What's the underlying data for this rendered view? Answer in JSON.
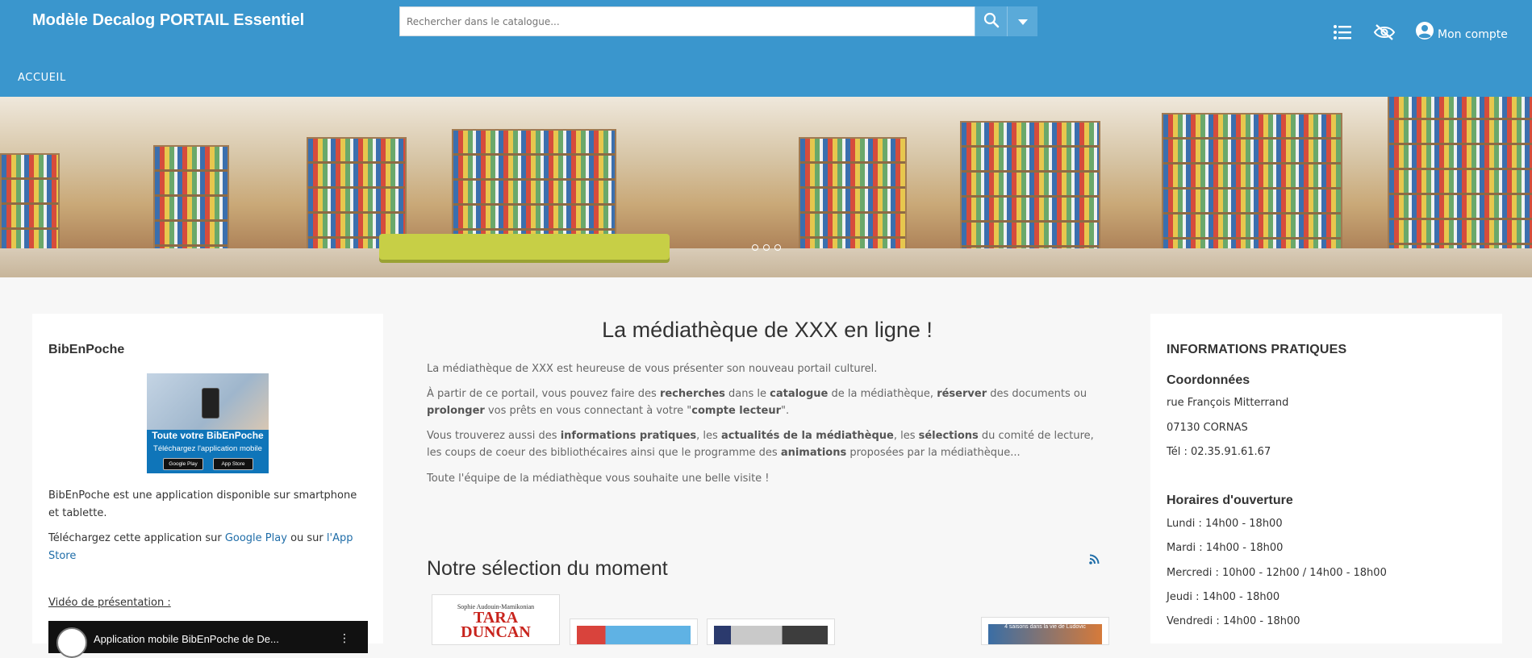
{
  "header": {
    "site_title": "Modèle Decalog PORTAIL Essentiel",
    "search_placeholder": "Rechercher dans le catalogue...",
    "account_label": "Mon compte",
    "nav_home": "ACCUEIL"
  },
  "left": {
    "title": "BibEnPoche",
    "app_title": "Toute votre BibEnPoche",
    "app_sub": "Téléchargez l'application mobile",
    "badge_google": "Google Play",
    "badge_apple": "App Store",
    "desc": "BibEnPoche est une application disponible sur smartphone et tablette.",
    "download_prefix": "Téléchargez cette application sur",
    "google_link": "Google Play",
    "or": "ou sur",
    "app_store_link": "l'App Store",
    "video_label": "Vidéo de présentation :",
    "video_title": "Application mobile BibEnPoche de De..."
  },
  "center": {
    "title": "La médiathèque de XXX en ligne !",
    "p1": "La médiathèque de XXX est heureuse de vous présenter son nouveau portail culturel.",
    "p2_a": "À partir de ce portail, vous pouvez faire des",
    "p2_b": "recherches",
    "p2_c": "dans le",
    "p2_d": "catalogue",
    "p2_e": "de la médiathèque,",
    "p2_f": "réserver",
    "p2_g": "des documents ou",
    "p2_h": "prolonger",
    "p2_i": "vos prêts en vous connectant à votre \"",
    "p2_j": "compte lecteur",
    "p2_k": "\".",
    "p3_a": "Vous trouverez aussi des",
    "p3_b": "informations pratiques",
    "p3_c": ", les",
    "p3_d": "actualités de la médiathèque",
    "p3_e": ", les",
    "p3_f": "sélections",
    "p3_g": "du comité de lecture, les coups de coeur des bibliothécaires ainsi que le programme des",
    "p3_h": "animations",
    "p3_i": "proposées par la médiathèque...",
    "p4": "Toute l'équipe de la médiathèque vous souhaite une belle visite !",
    "selection_title": "Notre sélection du moment",
    "book1_author": "Sophie Audouin-Mamikonian",
    "book1_title": "TARA DUNCAN",
    "book4_title": "4 saisons dans la vie de Ludovic"
  },
  "right": {
    "title": "INFORMATIONS PRATIQUES",
    "coords_title": "Coordonnées",
    "address": "rue François Mitterrand",
    "city": "07130 CORNAS",
    "phone": "Tél : 02.35.91.61.67",
    "hours_title": "Horaires d'ouverture",
    "hours": [
      "Lundi : 14h00 - 18h00",
      "Mardi : 14h00 - 18h00",
      "Mercredi : 10h00 - 12h00 / 14h00 - 18h00",
      "Jeudi : 14h00 - 18h00",
      "Vendredi : 14h00 - 18h00"
    ]
  },
  "colors": {
    "header_bg": "#3a96cd",
    "link": "#1f6da8"
  }
}
